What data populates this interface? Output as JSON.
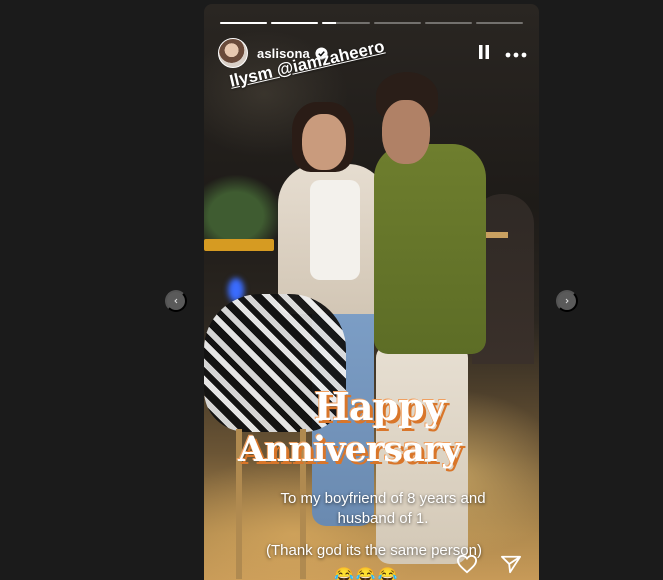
{
  "story": {
    "progress": [
      1,
      1,
      0.3,
      0,
      0,
      0
    ],
    "username": "aslisona",
    "overlay_text": "Ilysm @iamzaheero",
    "title_line1": "Happy",
    "title_line2": "Anniversary",
    "caption_line1": "To my boyfriend of 8 years and husband of 1.",
    "caption_line2": "(Thank god its the same person)",
    "emojis": "😂😂😂"
  },
  "icons": {
    "verified": "verified-icon",
    "pause": "pause-icon",
    "more": "more-icon",
    "heart": "heart-icon",
    "share": "send-icon",
    "prev": "chevron-left-icon",
    "next": "chevron-right-icon"
  },
  "colors": {
    "accent": "#d9762a",
    "background": "#1b1b1b",
    "shirt": "#6e7e2e"
  }
}
